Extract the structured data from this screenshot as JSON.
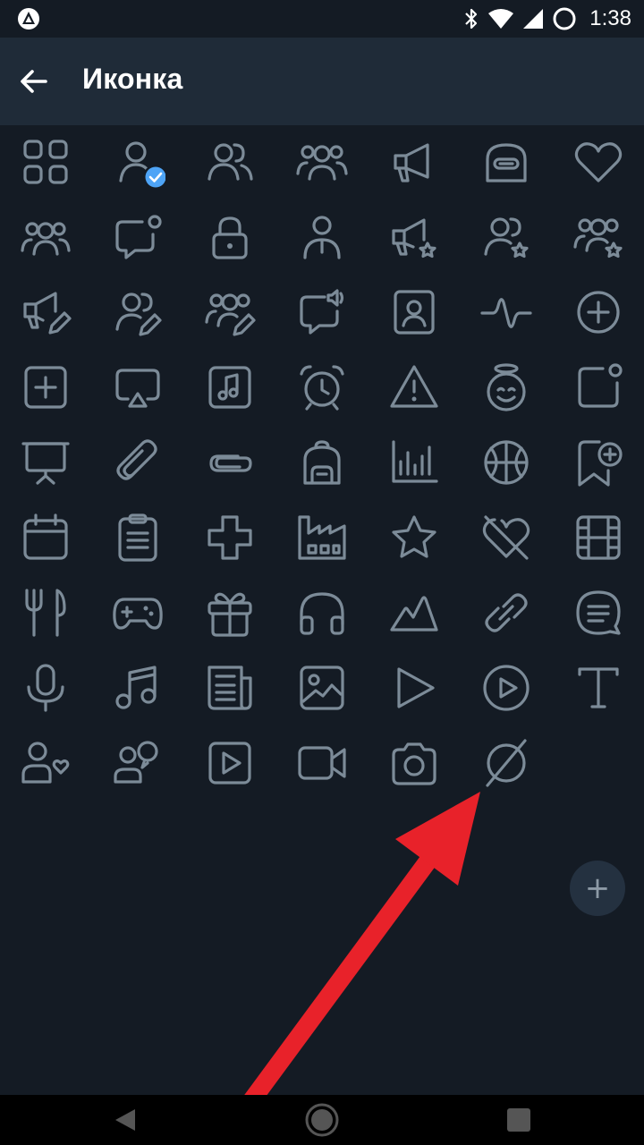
{
  "status_bar": {
    "time": "1:38",
    "icons": [
      "bluetooth-icon",
      "wifi-icon",
      "signal-icon",
      "dnd-icon"
    ]
  },
  "app_bar": {
    "title": "Иконка",
    "back_icon": "arrow-left-icon"
  },
  "icon_grid": {
    "rows": [
      [
        "grid",
        "user",
        "users",
        "group",
        "megaphone",
        "robot",
        "heart"
      ],
      [
        "group-alt",
        "chat-badge",
        "lock",
        "person-tie",
        "megaphone-star",
        "users-star",
        "group-star"
      ],
      [
        "megaphone-edit",
        "users-edit",
        "group-edit",
        "chat-sound",
        "contact",
        "pulse",
        "plus-circle"
      ],
      [
        "plus-square",
        "airplay",
        "music-square",
        "alarm",
        "warning",
        "angel",
        "square-badge"
      ],
      [
        "presentation",
        "paperclip",
        "clip",
        "backpack",
        "bar-chart",
        "basketball",
        "bookmark-plus"
      ],
      [
        "calendar",
        "clipboard",
        "cross",
        "factory",
        "star",
        "broken-heart",
        "film"
      ],
      [
        "cutlery",
        "gamepad",
        "gift",
        "headphones",
        "mountains",
        "link",
        "chat-lines"
      ],
      [
        "microphone",
        "music-note",
        "newspaper",
        "image",
        "play",
        "play-circle",
        "text-t"
      ],
      [
        "user-heart",
        "users-chat",
        "video-square",
        "video-camera",
        "camera",
        "no-icon"
      ]
    ],
    "selected": "user",
    "add_button_label": "+"
  },
  "colors": {
    "background": "#141b24",
    "appbar": "#1f2b38",
    "icon": "#7c8b98",
    "check": "#4ea4f6",
    "annotation_arrow": "#e8222a"
  },
  "nav_bar": {
    "buttons": [
      "back-triangle-icon",
      "home-circle-icon",
      "recents-square-icon"
    ]
  }
}
